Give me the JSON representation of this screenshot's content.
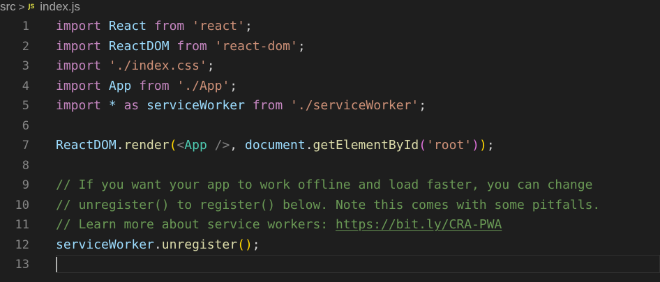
{
  "breadcrumb": {
    "folder": "src",
    "separator": ">",
    "file_icon": "JS",
    "file_icon_name": "javascript-file-icon",
    "file": "index.js"
  },
  "colors": {
    "background": "#1e1e1e",
    "keyword": "#c586c0",
    "variable": "#9cdcfe",
    "function": "#dcdcaa",
    "string": "#ce9178",
    "comment": "#6a9955",
    "component": "#4ec9b0",
    "line_number": "#858585"
  },
  "editor": {
    "current_line": 13,
    "lines": [
      {
        "num": "1",
        "tokens": [
          [
            "import",
            "kw"
          ],
          [
            " ",
            "pun"
          ],
          [
            "React",
            "var"
          ],
          [
            " ",
            "pun"
          ],
          [
            "from",
            "kw"
          ],
          [
            " ",
            "pun"
          ],
          [
            "'react'",
            "str"
          ],
          [
            ";",
            "pun"
          ]
        ]
      },
      {
        "num": "2",
        "tokens": [
          [
            "import",
            "kw"
          ],
          [
            " ",
            "pun"
          ],
          [
            "ReactDOM",
            "var"
          ],
          [
            " ",
            "pun"
          ],
          [
            "from",
            "kw"
          ],
          [
            " ",
            "pun"
          ],
          [
            "'react-dom'",
            "str"
          ],
          [
            ";",
            "pun"
          ]
        ]
      },
      {
        "num": "3",
        "tokens": [
          [
            "import",
            "kw"
          ],
          [
            " ",
            "pun"
          ],
          [
            "'./index.css'",
            "str"
          ],
          [
            ";",
            "pun"
          ]
        ]
      },
      {
        "num": "4",
        "tokens": [
          [
            "import",
            "kw"
          ],
          [
            " ",
            "pun"
          ],
          [
            "App",
            "var"
          ],
          [
            " ",
            "pun"
          ],
          [
            "from",
            "kw"
          ],
          [
            " ",
            "pun"
          ],
          [
            "'./App'",
            "str"
          ],
          [
            ";",
            "pun"
          ]
        ]
      },
      {
        "num": "5",
        "tokens": [
          [
            "import",
            "kw"
          ],
          [
            " ",
            "pun"
          ],
          [
            "*",
            "var"
          ],
          [
            " ",
            "pun"
          ],
          [
            "as",
            "kw"
          ],
          [
            " ",
            "pun"
          ],
          [
            "serviceWorker",
            "var"
          ],
          [
            " ",
            "pun"
          ],
          [
            "from",
            "kw"
          ],
          [
            " ",
            "pun"
          ],
          [
            "'./serviceWorker'",
            "str"
          ],
          [
            ";",
            "pun"
          ]
        ]
      },
      {
        "num": "6",
        "tokens": []
      },
      {
        "num": "7",
        "tokens": [
          [
            "ReactDOM",
            "var"
          ],
          [
            ".",
            "pun"
          ],
          [
            "render",
            "fn"
          ],
          [
            "(",
            "br1"
          ],
          [
            "<",
            "jsx"
          ],
          [
            "App",
            "tag"
          ],
          [
            " />",
            "jsx"
          ],
          [
            ", ",
            "pun"
          ],
          [
            "document",
            "var"
          ],
          [
            ".",
            "pun"
          ],
          [
            "getElementById",
            "fn"
          ],
          [
            "(",
            "br2"
          ],
          [
            "'root'",
            "str"
          ],
          [
            ")",
            "br2"
          ],
          [
            ")",
            "br1"
          ],
          [
            ";",
            "pun"
          ]
        ]
      },
      {
        "num": "8",
        "tokens": []
      },
      {
        "num": "9",
        "tokens": [
          [
            "// If you want your app to work offline and load faster, you can change",
            "cmt"
          ]
        ]
      },
      {
        "num": "10",
        "tokens": [
          [
            "// unregister() to register() below. Note this comes with some pitfalls.",
            "cmt"
          ]
        ]
      },
      {
        "num": "11",
        "tokens": [
          [
            "// Learn more about service workers: ",
            "cmt"
          ],
          [
            "https://bit.ly/CRA-PWA",
            "cmt link"
          ]
        ]
      },
      {
        "num": "12",
        "tokens": [
          [
            "serviceWorker",
            "var"
          ],
          [
            ".",
            "pun"
          ],
          [
            "unregister",
            "fn"
          ],
          [
            "(",
            "br1"
          ],
          [
            ")",
            "br1"
          ],
          [
            ";",
            "pun"
          ]
        ]
      },
      {
        "num": "13",
        "tokens": []
      }
    ]
  }
}
